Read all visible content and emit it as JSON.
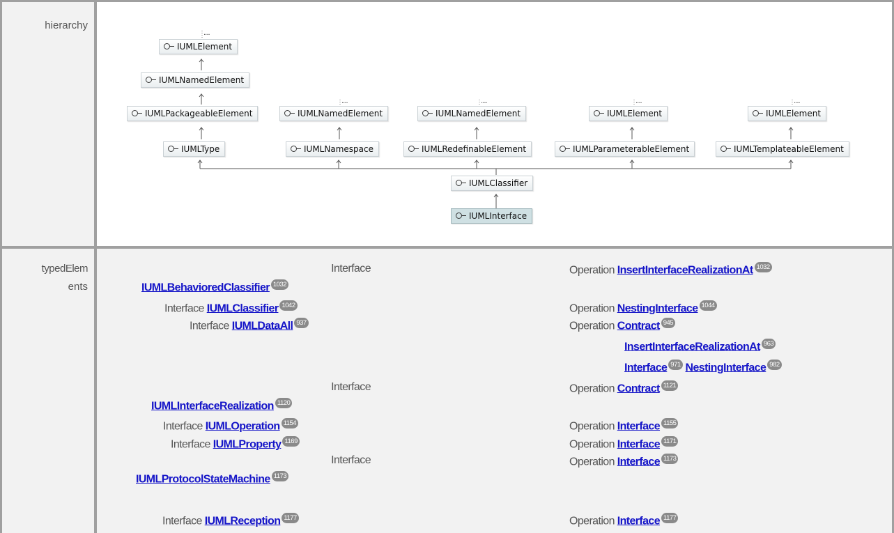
{
  "labels": {
    "hierarchy": "hierarchy",
    "typed_line1": "typedElem",
    "typed_line2": "ents"
  },
  "hierarchy": {
    "nodes": {
      "top_element": "IUMLElement",
      "named_element": "IUMLNamedElement",
      "packageable": "IUMLPackageableElement",
      "named_element2": "IUMLNamedElement",
      "named_element3": "IUMLNamedElement",
      "element2": "IUMLElement",
      "element3": "IUMLElement",
      "type": "IUMLType",
      "namespace": "IUMLNamespace",
      "redefinable": "IUMLRedefinableElement",
      "parameterable": "IUMLParameterableElement",
      "templateable": "IUMLTemplateableElement",
      "classifier": "IUMLClassifier",
      "interface": "IUMLInterface"
    },
    "ellipsis": "....",
    "icon": "interface-lollipop-icon"
  },
  "typed_elements": {
    "interface_word": "Interface",
    "operation_word": "Operation",
    "rows": [
      {
        "iface": "IUMLBehavioredClassifier",
        "iface_badge": "1032",
        "op": "InsertInterfaceRealizationAt",
        "op_badge": "1032"
      },
      {
        "iface": "IUMLClassifier",
        "iface_badge": "1042",
        "op": "NestingInterface",
        "op_badge": "1044"
      },
      {
        "iface": "IUMLDataAll",
        "iface_badge": "937",
        "op": "Contract",
        "op_badge": "945",
        "extra": [
          {
            "name": "InsertInterfaceRealizationAt",
            "badge": "963"
          },
          {
            "name": "Interface",
            "badge": "971"
          },
          {
            "name": "NestingInterface",
            "badge": "982"
          }
        ]
      },
      {
        "iface": "IUMLInterfaceRealization",
        "iface_badge": "1120",
        "op": "Contract",
        "op_badge": "1121"
      },
      {
        "iface": "IUMLOperation",
        "iface_badge": "1154",
        "op": "Interface",
        "op_badge": "1155"
      },
      {
        "iface": "IUMLProperty",
        "iface_badge": "1169",
        "op": "Interface",
        "op_badge": "1171"
      },
      {
        "iface": "IUMLProtocolStateMachine",
        "iface_badge": "1173",
        "op": "Interface",
        "op_badge": "1173"
      },
      {
        "iface": "IUMLReception",
        "iface_badge": "1177",
        "op": "Interface",
        "op_badge": "1177"
      }
    ]
  },
  "colors": {
    "link": "#1515c8",
    "badge": "#8a8a8a",
    "selected_node": "#cfe0e3",
    "grid": "#a0a0a0"
  }
}
